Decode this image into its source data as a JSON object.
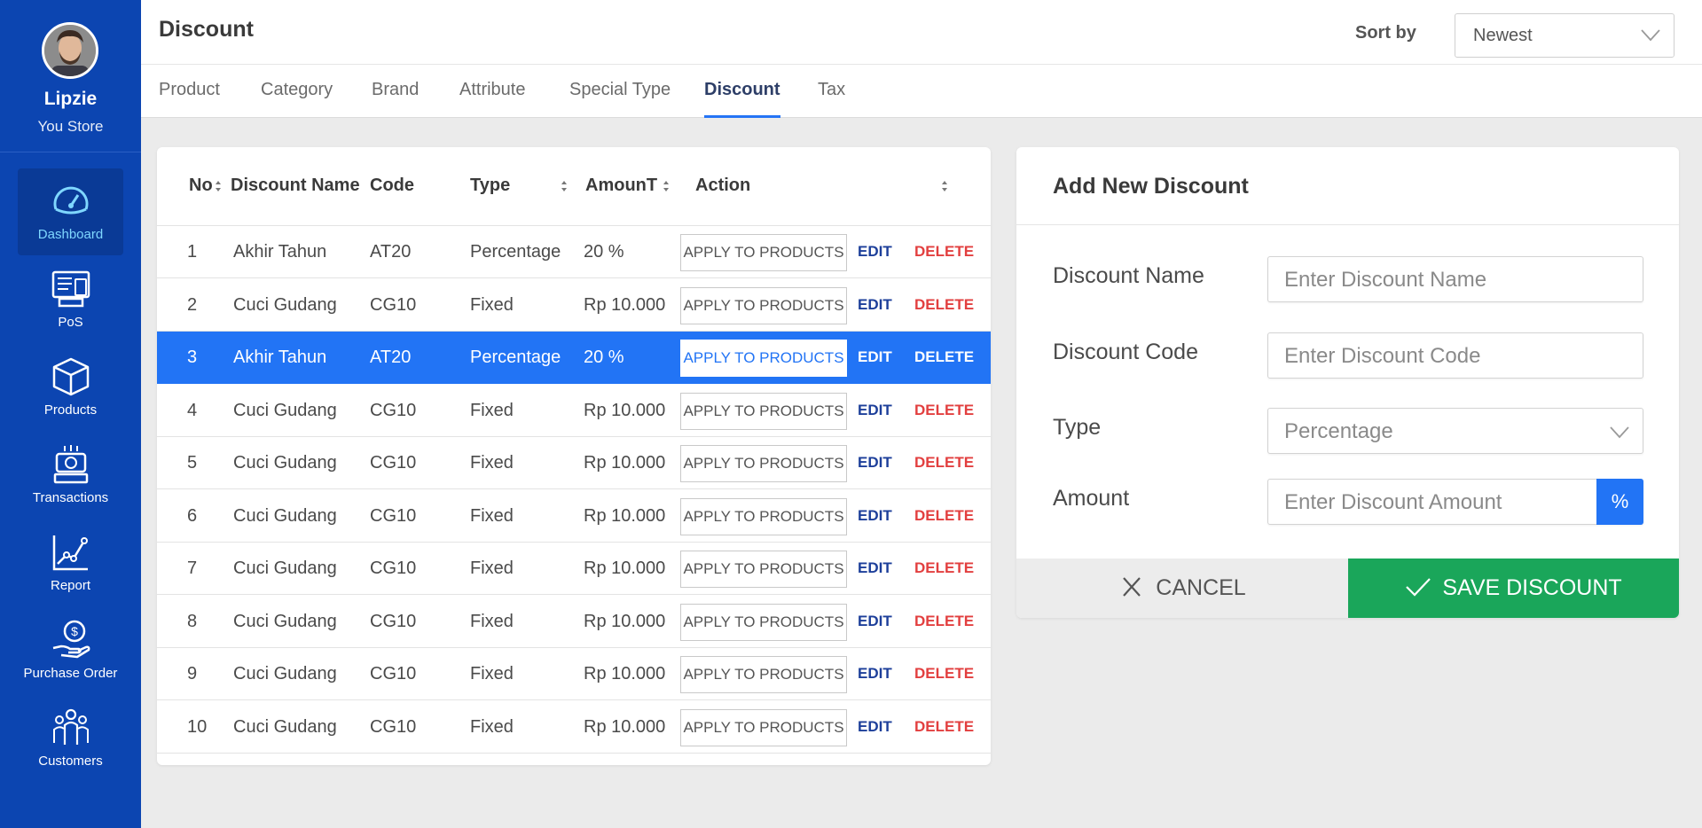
{
  "profile": {
    "name": "Lipzie",
    "store": "You Store"
  },
  "nav": [
    {
      "label": "Dashboard",
      "icon": "gauge-icon"
    },
    {
      "label": "PoS",
      "icon": "pos-terminal-icon"
    },
    {
      "label": "Products",
      "icon": "box-icon"
    },
    {
      "label": "Transactions",
      "icon": "transaction-icon"
    },
    {
      "label": "Report",
      "icon": "chart-line-icon"
    },
    {
      "label": "Purchase Order",
      "icon": "money-hand-icon"
    },
    {
      "label": "Customers",
      "icon": "people-icon"
    }
  ],
  "header": {
    "title": "Discount",
    "sort_label": "Sort by",
    "sort_value": "Newest"
  },
  "tabs": [
    "Product",
    "Category",
    "Brand",
    "Attribute",
    "Special Type",
    "Discount",
    "Tax"
  ],
  "active_tab": "Discount",
  "table": {
    "columns": [
      "No",
      "Discount Name",
      "Code",
      "Type",
      "AmounT",
      "Action"
    ],
    "apply_label": "APPLY TO PRODUCTS",
    "edit_label": "EDIT",
    "delete_label": "DELETE",
    "rows": [
      {
        "no": "1",
        "name": "Akhir Tahun",
        "code": "AT20",
        "type": "Percentage",
        "amount": "20 %"
      },
      {
        "no": "2",
        "name": "Cuci Gudang",
        "code": "CG10",
        "type": "Fixed",
        "amount": "Rp 10.000"
      },
      {
        "no": "3",
        "name": "Akhir Tahun",
        "code": "AT20",
        "type": "Percentage",
        "amount": "20 %"
      },
      {
        "no": "4",
        "name": "Cuci Gudang",
        "code": "CG10",
        "type": "Fixed",
        "amount": "Rp 10.000"
      },
      {
        "no": "5",
        "name": "Cuci Gudang",
        "code": "CG10",
        "type": "Fixed",
        "amount": "Rp 10.000"
      },
      {
        "no": "6",
        "name": "Cuci Gudang",
        "code": "CG10",
        "type": "Fixed",
        "amount": "Rp 10.000"
      },
      {
        "no": "7",
        "name": "Cuci Gudang",
        "code": "CG10",
        "type": "Fixed",
        "amount": "Rp 10.000"
      },
      {
        "no": "8",
        "name": "Cuci Gudang",
        "code": "CG10",
        "type": "Fixed",
        "amount": "Rp 10.000"
      },
      {
        "no": "9",
        "name": "Cuci Gudang",
        "code": "CG10",
        "type": "Fixed",
        "amount": "Rp 10.000"
      },
      {
        "no": "10",
        "name": "Cuci Gudang",
        "code": "CG10",
        "type": "Fixed",
        "amount": "Rp 10.000"
      }
    ]
  },
  "form": {
    "title": "Add New Discount",
    "name_label": "Discount Name",
    "name_placeholder": "Enter Discount Name",
    "code_label": "Discount Code",
    "code_placeholder": "Enter Discount Code",
    "type_label": "Type",
    "type_value": "Percentage",
    "amount_label": "Amount",
    "amount_placeholder": "Enter Discount Amount",
    "amount_unit": "%",
    "cancel_label": "CANCEL",
    "save_label": "SAVE DISCOUNT"
  },
  "colors": {
    "sidebar": "#0c45b1",
    "accent": "#2274f5",
    "save": "#1aa65a",
    "delete": "#e23f3f",
    "edit": "#1d3f9a"
  }
}
